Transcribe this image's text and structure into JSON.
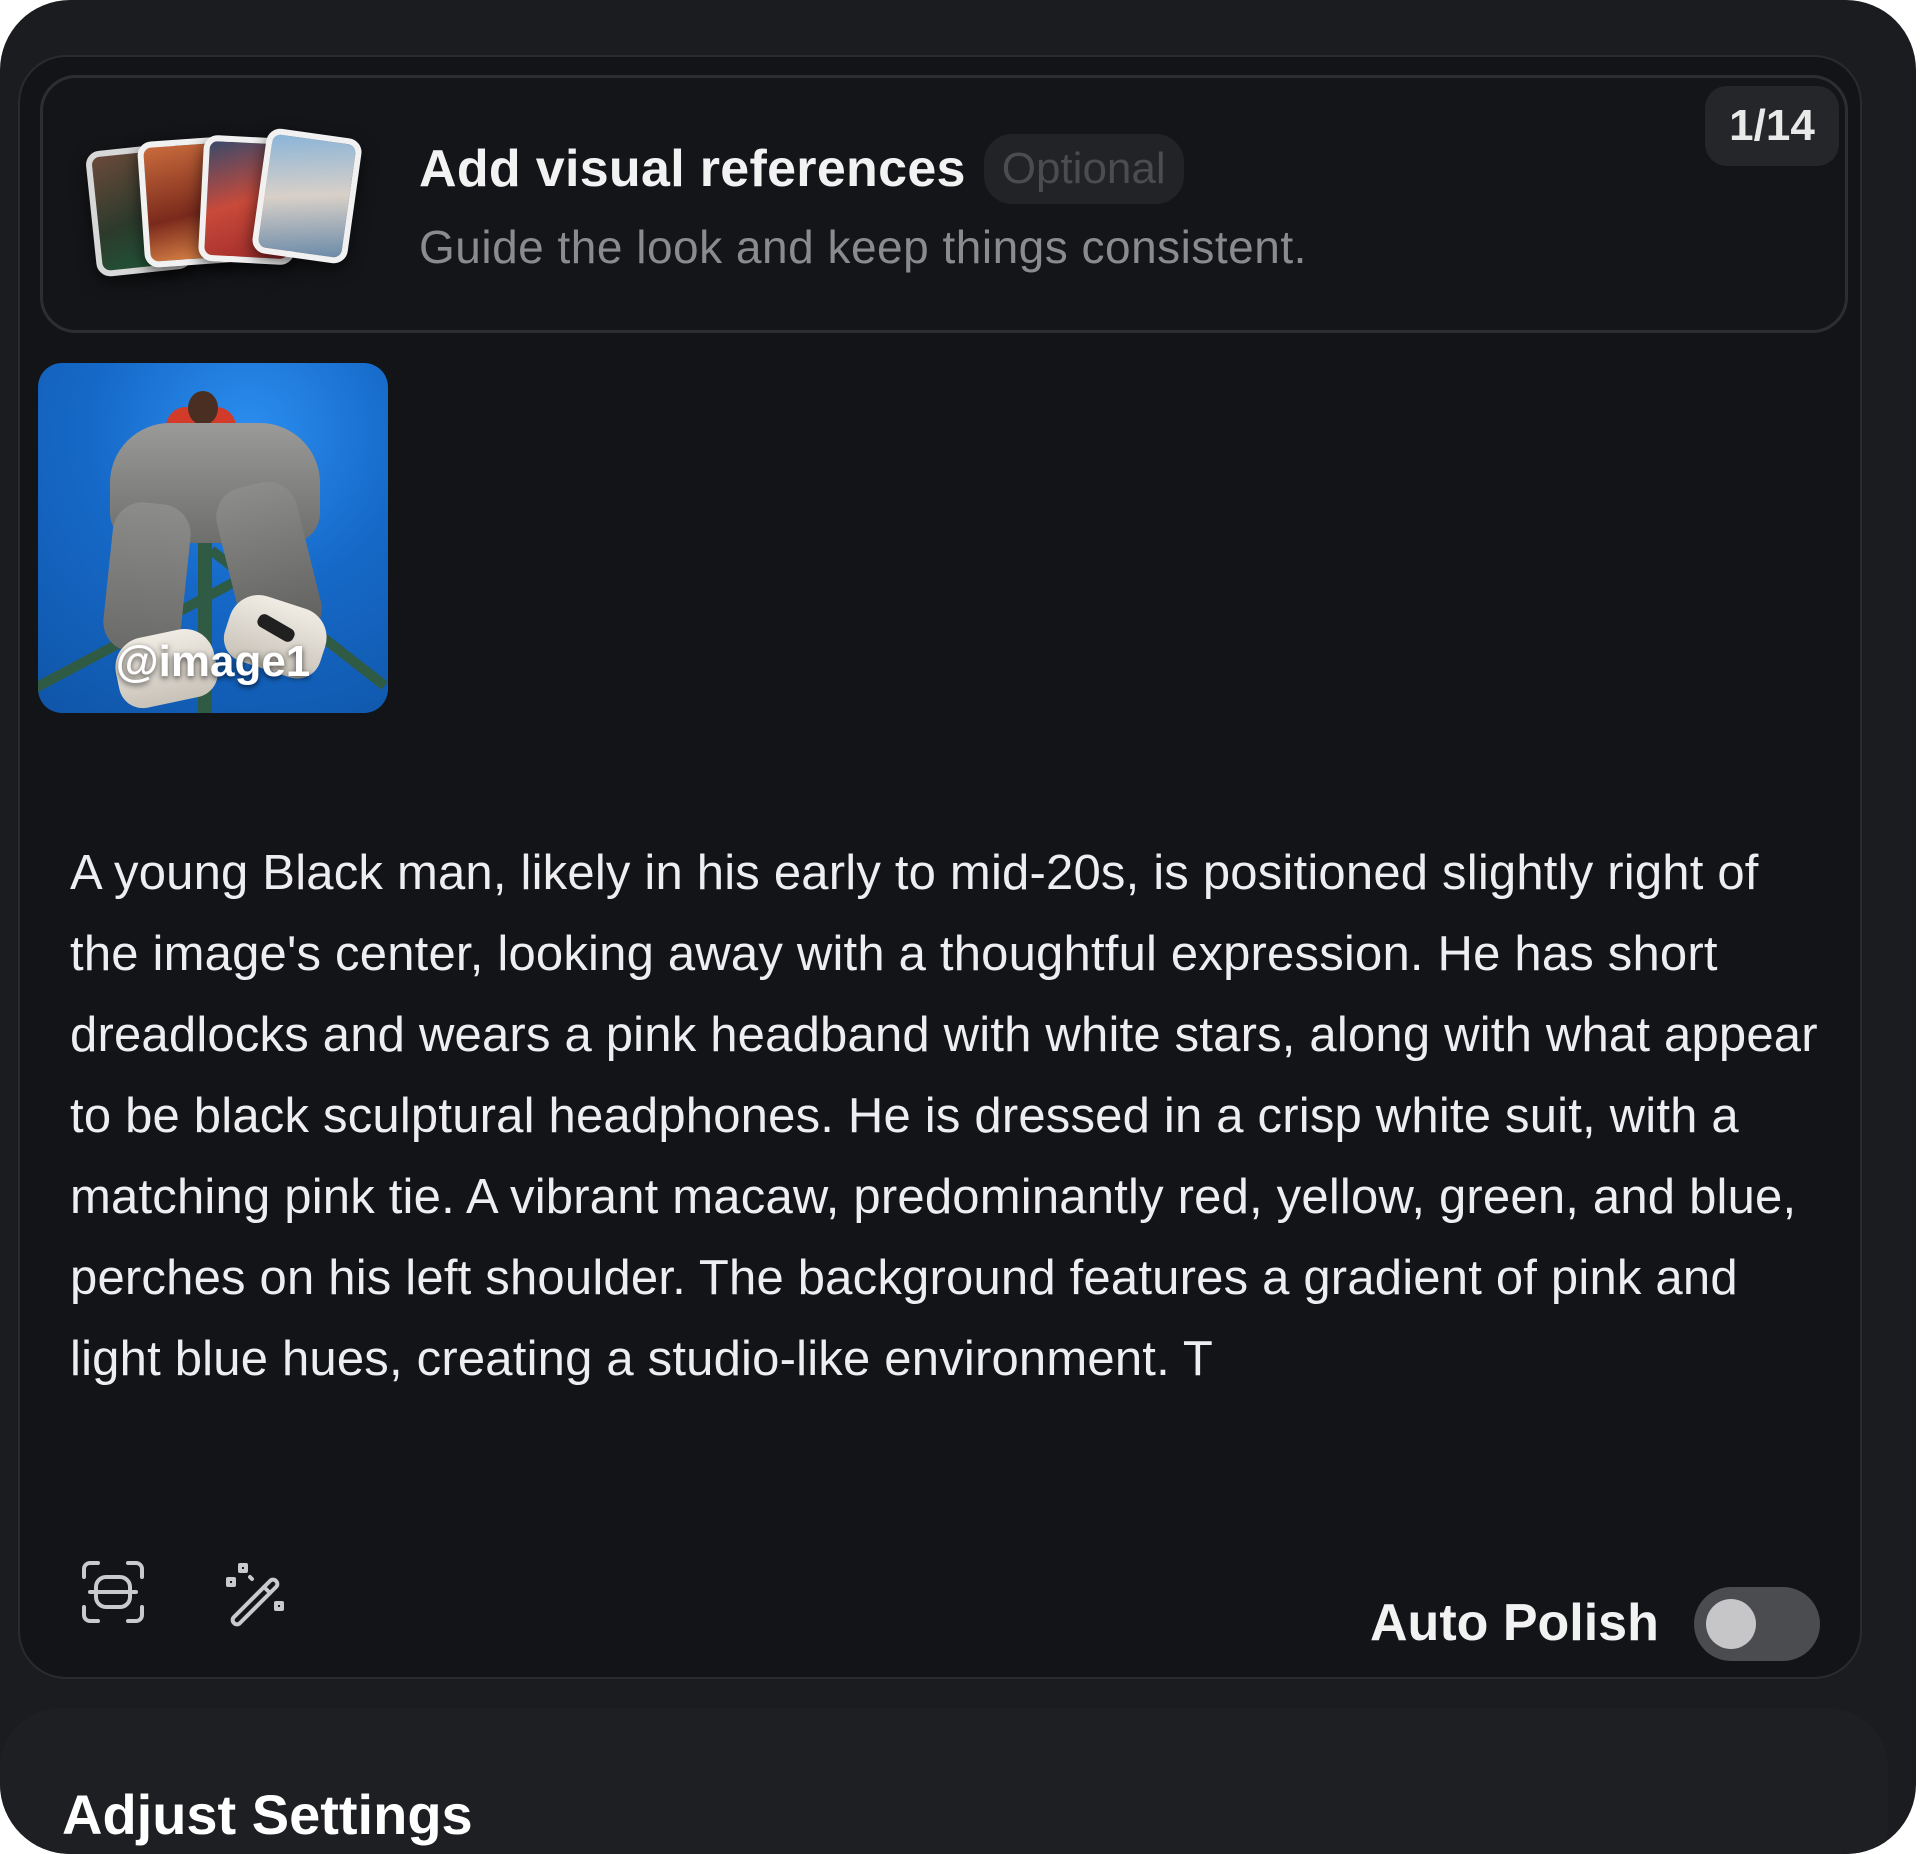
{
  "references": {
    "title": "Add visual references",
    "badge": "Optional",
    "subtitle": "Guide the look and keep things consistent.",
    "counter": "1/14",
    "thumbnail_icons": [
      "photo-stack-icon"
    ]
  },
  "image_tiles": [
    {
      "label": "@image1"
    }
  ],
  "prompt": {
    "text": "A young Black man, likely in his early to mid-20s, is positioned slightly right of the image's center, looking away with a thoughtful expression. He has short dreadlocks and wears a pink headband with white stars, along with what appear to be black sculptural headphones. He is dressed in a crisp white suit, with a matching pink tie. A vibrant macaw, predominantly red, yellow, green, and blue, perches on his left shoulder. The background features a gradient of pink and light blue hues, creating a studio-like environment. T"
  },
  "toolbar": {
    "icons": [
      "scan-icon",
      "magic-wand-icon"
    ],
    "auto_polish_label": "Auto Polish",
    "auto_polish_on": false
  },
  "settings": {
    "title": "Adjust Settings"
  },
  "colors": {
    "background": "#1b1c1f",
    "panel": "#131417",
    "toggle_off": "#4b4c50"
  }
}
